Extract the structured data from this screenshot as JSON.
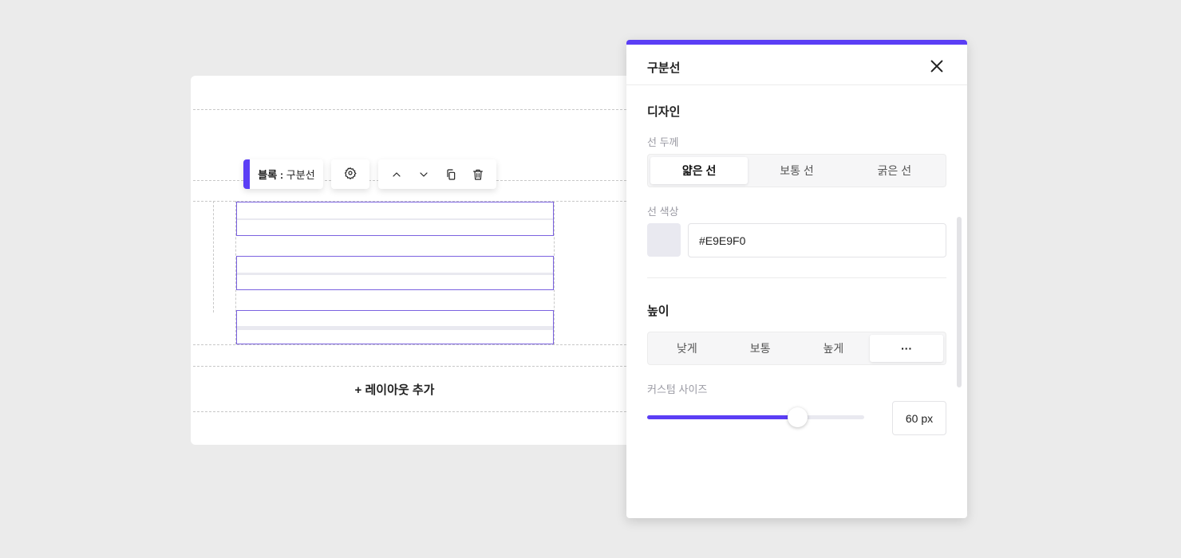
{
  "toolbar": {
    "block_prefix": "블록 :",
    "block_name": "구분선"
  },
  "canvas": {
    "add_layout": "+ 레이아웃 추가"
  },
  "panel": {
    "title": "구분선",
    "design_heading": "디자인",
    "thickness": {
      "label": "선 두께",
      "options": [
        "얇은 선",
        "보통 선",
        "굵은 선"
      ],
      "selected": 0
    },
    "color": {
      "label": "선 색상",
      "value": "#E9E9F0"
    },
    "height": {
      "heading": "높이",
      "options": [
        "낮게",
        "보통",
        "높게",
        "···"
      ],
      "selected": 3
    },
    "custom_size": {
      "label": "커스텀 사이즈",
      "value": "60 px",
      "slider_fraction": 0.69
    }
  },
  "colors": {
    "accent": "#5b3ef5",
    "divider": "#E9E9F0"
  }
}
